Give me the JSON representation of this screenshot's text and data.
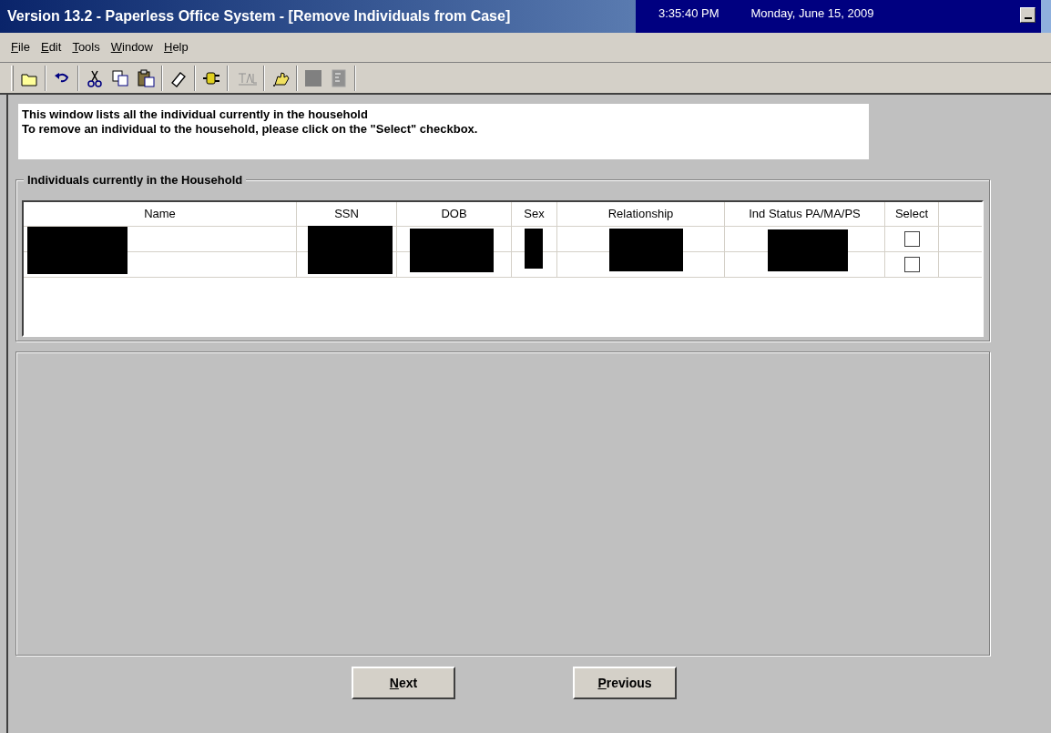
{
  "window": {
    "title": "Version 13.2 - Paperless Office System - [Remove Individuals from Case]",
    "time": "3:35:40 PM",
    "date": "Monday, June 15, 2009"
  },
  "menu": [
    "File",
    "Edit",
    "Tools",
    "Window",
    "Help"
  ],
  "instructions": [
    "This window lists all the individual currently in the household",
    "To remove an individual to the household, please click on the \"Select\" checkbox."
  ],
  "group": {
    "title": "Individuals currently in the Household",
    "table": {
      "columns": [
        "Name",
        "SSN",
        "DOB",
        "Sex",
        "Relationship",
        "Ind Status PA/MA/PS",
        "Select"
      ],
      "rows": [
        {
          "select_checked": false
        },
        {
          "select_checked": false
        }
      ]
    }
  },
  "buttons": [
    "Next",
    "Previous"
  ]
}
